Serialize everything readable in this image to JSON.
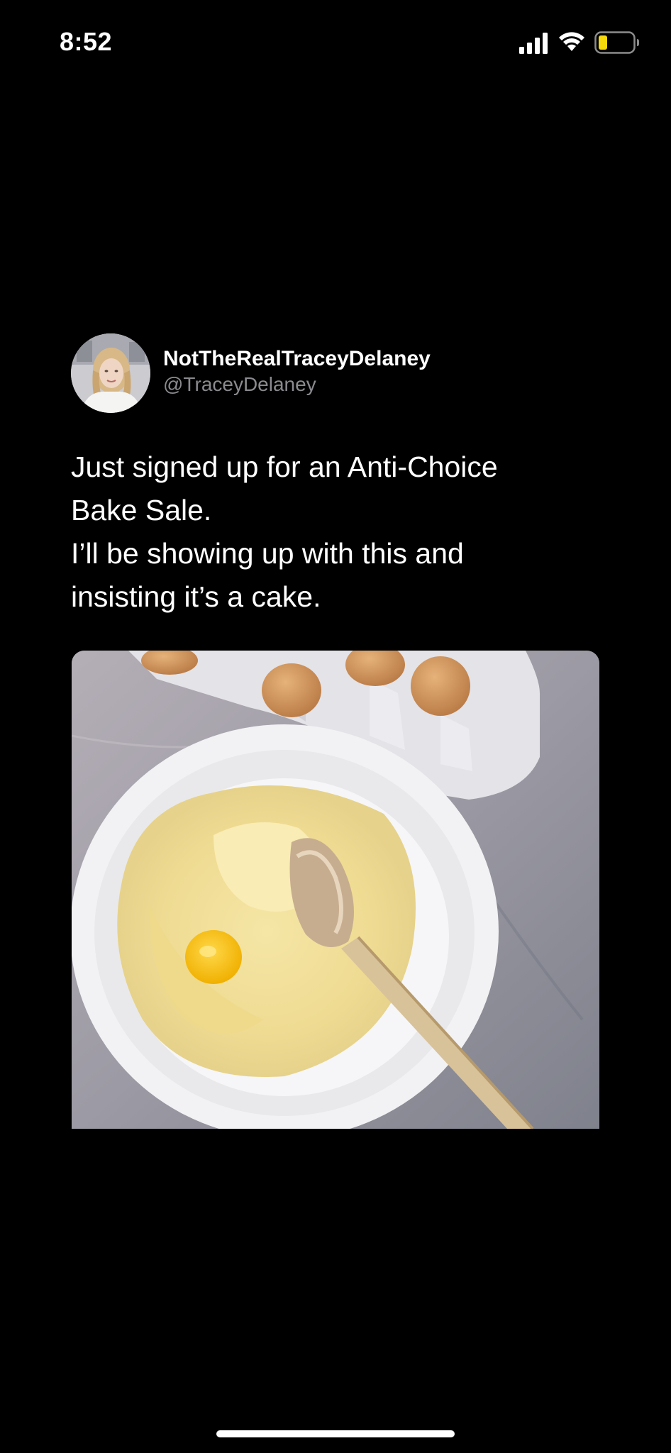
{
  "status_bar": {
    "time": "8:52",
    "icons": [
      "signal-icon",
      "wifi-icon",
      "battery-icon"
    ],
    "battery_color": "#f5d90a"
  },
  "tweet": {
    "author": {
      "display_name": "NotTheRealTraceyDelaney",
      "handle": "@TraceyDelaney",
      "avatar": "avatar"
    },
    "text_lines": [
      "Just signed up for an Anti-Choice",
      "Bake Sale.",
      "I’ll be showing up with this and",
      "insisting it’s a cake."
    ],
    "media": {
      "kind": "photo",
      "subject": "mixing bowl with batter, cracked egg, wooden spoon, egg carton"
    }
  },
  "colors": {
    "background": "#000000",
    "text": "#ffffff",
    "handle": "#8b8b8f"
  }
}
